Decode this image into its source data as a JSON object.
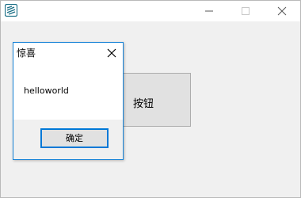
{
  "window": {
    "icon": "app-icon",
    "controls": [
      "minimize-icon",
      "maximize-icon",
      "close-icon"
    ]
  },
  "main": {
    "button_label": "按钮"
  },
  "dialog": {
    "title": "惊喜",
    "message": "helloworld",
    "ok_label": "确定",
    "accent": "#0078d7"
  }
}
